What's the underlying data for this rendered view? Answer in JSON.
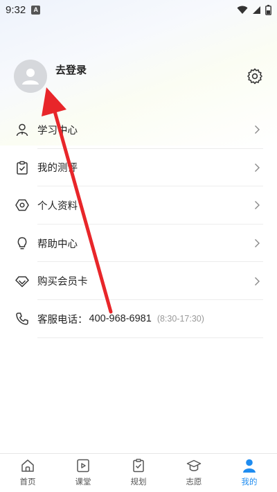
{
  "status_bar": {
    "time": "9:32",
    "notification_badge": "A"
  },
  "profile": {
    "login_label": "去登录",
    "avatar_icon": "user-avatar-icon",
    "settings_icon": "gear-icon"
  },
  "menu": [
    {
      "label": "学习中心",
      "icon": "person-icon",
      "has_arrow": true
    },
    {
      "label": "我的测评",
      "icon": "clipboard-check-icon",
      "has_arrow": true
    },
    {
      "label": "个人资料",
      "icon": "hexagon-icon",
      "has_arrow": true
    },
    {
      "label": "帮助中心",
      "icon": "lightbulb-icon",
      "has_arrow": true
    },
    {
      "label": "购买会员卡",
      "icon": "diamond-icon",
      "has_arrow": true
    }
  ],
  "service": {
    "label": "客服电话：",
    "phone": "400-968-6981",
    "hours": "(8:30-17:30)",
    "icon": "phone-icon"
  },
  "tabbar": {
    "active_color": "#1f8cf0",
    "items": [
      {
        "label": "首页",
        "icon": "home-icon",
        "active": false
      },
      {
        "label": "课堂",
        "icon": "play-icon",
        "active": false
      },
      {
        "label": "规划",
        "icon": "clipboard-icon",
        "active": false
      },
      {
        "label": "志愿",
        "icon": "graduation-cap-icon",
        "active": false
      },
      {
        "label": "我的",
        "icon": "person-filled-icon",
        "active": true
      }
    ]
  },
  "annotation": {
    "arrow_color": "#e8262a"
  }
}
